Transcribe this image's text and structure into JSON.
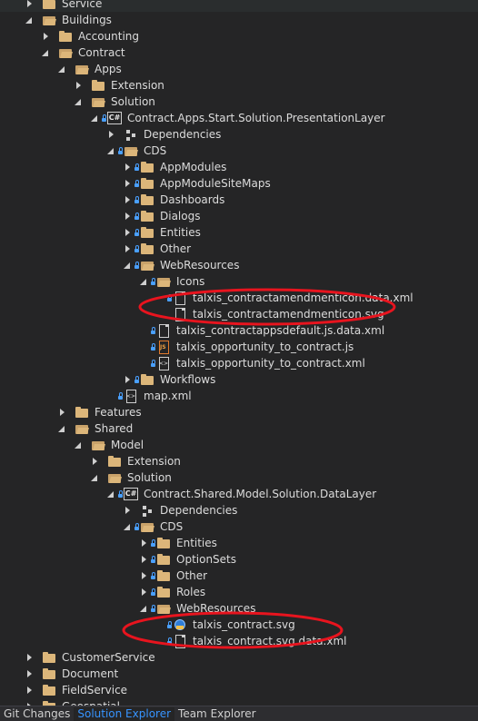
{
  "tree": [
    {
      "label": "Service",
      "depth": 1,
      "arrow": "collapsed",
      "icon": "folder-icon",
      "lock": false
    },
    {
      "label": "Buildings",
      "depth": 1,
      "arrow": "expanded",
      "icon": "folder-open-icon",
      "lock": false
    },
    {
      "label": "Accounting",
      "depth": 2,
      "arrow": "collapsed",
      "icon": "folder-icon",
      "lock": false
    },
    {
      "label": "Contract",
      "depth": 2,
      "arrow": "expanded",
      "icon": "folder-open-icon",
      "lock": false
    },
    {
      "label": "Apps",
      "depth": 3,
      "arrow": "expanded",
      "icon": "folder-open-icon",
      "lock": false
    },
    {
      "label": "Extension",
      "depth": 4,
      "arrow": "collapsed",
      "icon": "folder-icon",
      "lock": false
    },
    {
      "label": "Solution",
      "depth": 4,
      "arrow": "expanded",
      "icon": "folder-open-icon",
      "lock": false
    },
    {
      "label": "Contract.Apps.Start.Solution.PresentationLayer",
      "depth": 5,
      "arrow": "expanded",
      "icon": "csharp-project-icon",
      "lock": true
    },
    {
      "label": "Dependencies",
      "depth": 6,
      "arrow": "collapsed",
      "icon": "dependencies-icon",
      "lock": false
    },
    {
      "label": "CDS",
      "depth": 6,
      "arrow": "expanded",
      "icon": "folder-open-icon",
      "lock": true
    },
    {
      "label": "AppModules",
      "depth": 7,
      "arrow": "collapsed",
      "icon": "folder-icon",
      "lock": true
    },
    {
      "label": "AppModuleSiteMaps",
      "depth": 7,
      "arrow": "collapsed",
      "icon": "folder-icon",
      "lock": true
    },
    {
      "label": "Dashboards",
      "depth": 7,
      "arrow": "collapsed",
      "icon": "folder-icon",
      "lock": true
    },
    {
      "label": "Dialogs",
      "depth": 7,
      "arrow": "collapsed",
      "icon": "folder-icon",
      "lock": true
    },
    {
      "label": "Entities",
      "depth": 7,
      "arrow": "collapsed",
      "icon": "folder-icon",
      "lock": true
    },
    {
      "label": "Other",
      "depth": 7,
      "arrow": "collapsed",
      "icon": "folder-icon",
      "lock": true
    },
    {
      "label": "WebResources",
      "depth": 7,
      "arrow": "expanded",
      "icon": "folder-open-icon",
      "lock": true
    },
    {
      "label": "Icons",
      "depth": 8,
      "arrow": "expanded",
      "icon": "folder-open-icon",
      "lock": true
    },
    {
      "label": "talxis_contractamendmenticon.data.xml",
      "depth": 9,
      "arrow": "none",
      "icon": "file-icon",
      "lock": true
    },
    {
      "label": "talxis_contractamendmenticon.svg",
      "depth": 9,
      "arrow": "none",
      "icon": "file-icon",
      "lock": false
    },
    {
      "label": "talxis_contractappsdefault.js.data.xml",
      "depth": 8,
      "arrow": "none",
      "icon": "file-icon",
      "lock": true
    },
    {
      "label": "talxis_opportunity_to_contract.js",
      "depth": 8,
      "arrow": "none",
      "icon": "javascript-file-icon",
      "lock": true
    },
    {
      "label": "talxis_opportunity_to_contract.xml",
      "depth": 8,
      "arrow": "none",
      "icon": "xml-file-icon",
      "lock": true
    },
    {
      "label": "Workflows",
      "depth": 7,
      "arrow": "collapsed",
      "icon": "folder-icon",
      "lock": true
    },
    {
      "label": "map.xml",
      "depth": 6,
      "arrow": "none",
      "icon": "xml-file-icon",
      "lock": true
    },
    {
      "label": "Features",
      "depth": 3,
      "arrow": "collapsed",
      "icon": "folder-icon",
      "lock": false
    },
    {
      "label": "Shared",
      "depth": 3,
      "arrow": "expanded",
      "icon": "folder-open-icon",
      "lock": false
    },
    {
      "label": "Model",
      "depth": 4,
      "arrow": "expanded",
      "icon": "folder-open-icon",
      "lock": false
    },
    {
      "label": "Extension",
      "depth": 5,
      "arrow": "collapsed",
      "icon": "folder-icon",
      "lock": false
    },
    {
      "label": "Solution",
      "depth": 5,
      "arrow": "expanded",
      "icon": "folder-open-icon",
      "lock": false
    },
    {
      "label": "Contract.Shared.Model.Solution.DataLayer",
      "depth": 6,
      "arrow": "expanded",
      "icon": "csharp-project-icon",
      "lock": true
    },
    {
      "label": "Dependencies",
      "depth": 7,
      "arrow": "collapsed",
      "icon": "dependencies-icon",
      "lock": false
    },
    {
      "label": "CDS",
      "depth": 7,
      "arrow": "expanded",
      "icon": "folder-open-icon",
      "lock": true
    },
    {
      "label": "Entities",
      "depth": 8,
      "arrow": "collapsed",
      "icon": "folder-icon",
      "lock": true
    },
    {
      "label": "OptionSets",
      "depth": 8,
      "arrow": "collapsed",
      "icon": "folder-icon",
      "lock": true
    },
    {
      "label": "Other",
      "depth": 8,
      "arrow": "collapsed",
      "icon": "folder-icon",
      "lock": true
    },
    {
      "label": "Roles",
      "depth": 8,
      "arrow": "collapsed",
      "icon": "folder-icon",
      "lock": true
    },
    {
      "label": "WebResources",
      "depth": 8,
      "arrow": "expanded",
      "icon": "folder-open-icon",
      "lock": true
    },
    {
      "label": "talxis_contract.svg",
      "depth": 9,
      "arrow": "none",
      "icon": "svg-file-icon",
      "lock": true
    },
    {
      "label": "talxis_contract.svg.data.xml",
      "depth": 9,
      "arrow": "none",
      "icon": "file-icon",
      "lock": true
    },
    {
      "label": "CustomerService",
      "depth": 1,
      "arrow": "collapsed",
      "icon": "folder-icon",
      "lock": false
    },
    {
      "label": "Document",
      "depth": 1,
      "arrow": "collapsed",
      "icon": "folder-icon",
      "lock": false
    },
    {
      "label": "FieldService",
      "depth": 1,
      "arrow": "collapsed",
      "icon": "folder-icon",
      "lock": false
    },
    {
      "label": "Geospatial",
      "depth": 1,
      "arrow": "collapsed",
      "icon": "folder-icon",
      "lock": false
    }
  ],
  "tabs": [
    {
      "label": "Git Changes",
      "active": false
    },
    {
      "label": "Solution Explorer",
      "active": true
    },
    {
      "label": "Team Explorer",
      "active": false
    }
  ],
  "colors": {
    "background": "#252526",
    "text": "#dcdcdc",
    "active_tab": "#3794ff",
    "annotation": "#e8141e",
    "folder": "#dcb67a"
  }
}
